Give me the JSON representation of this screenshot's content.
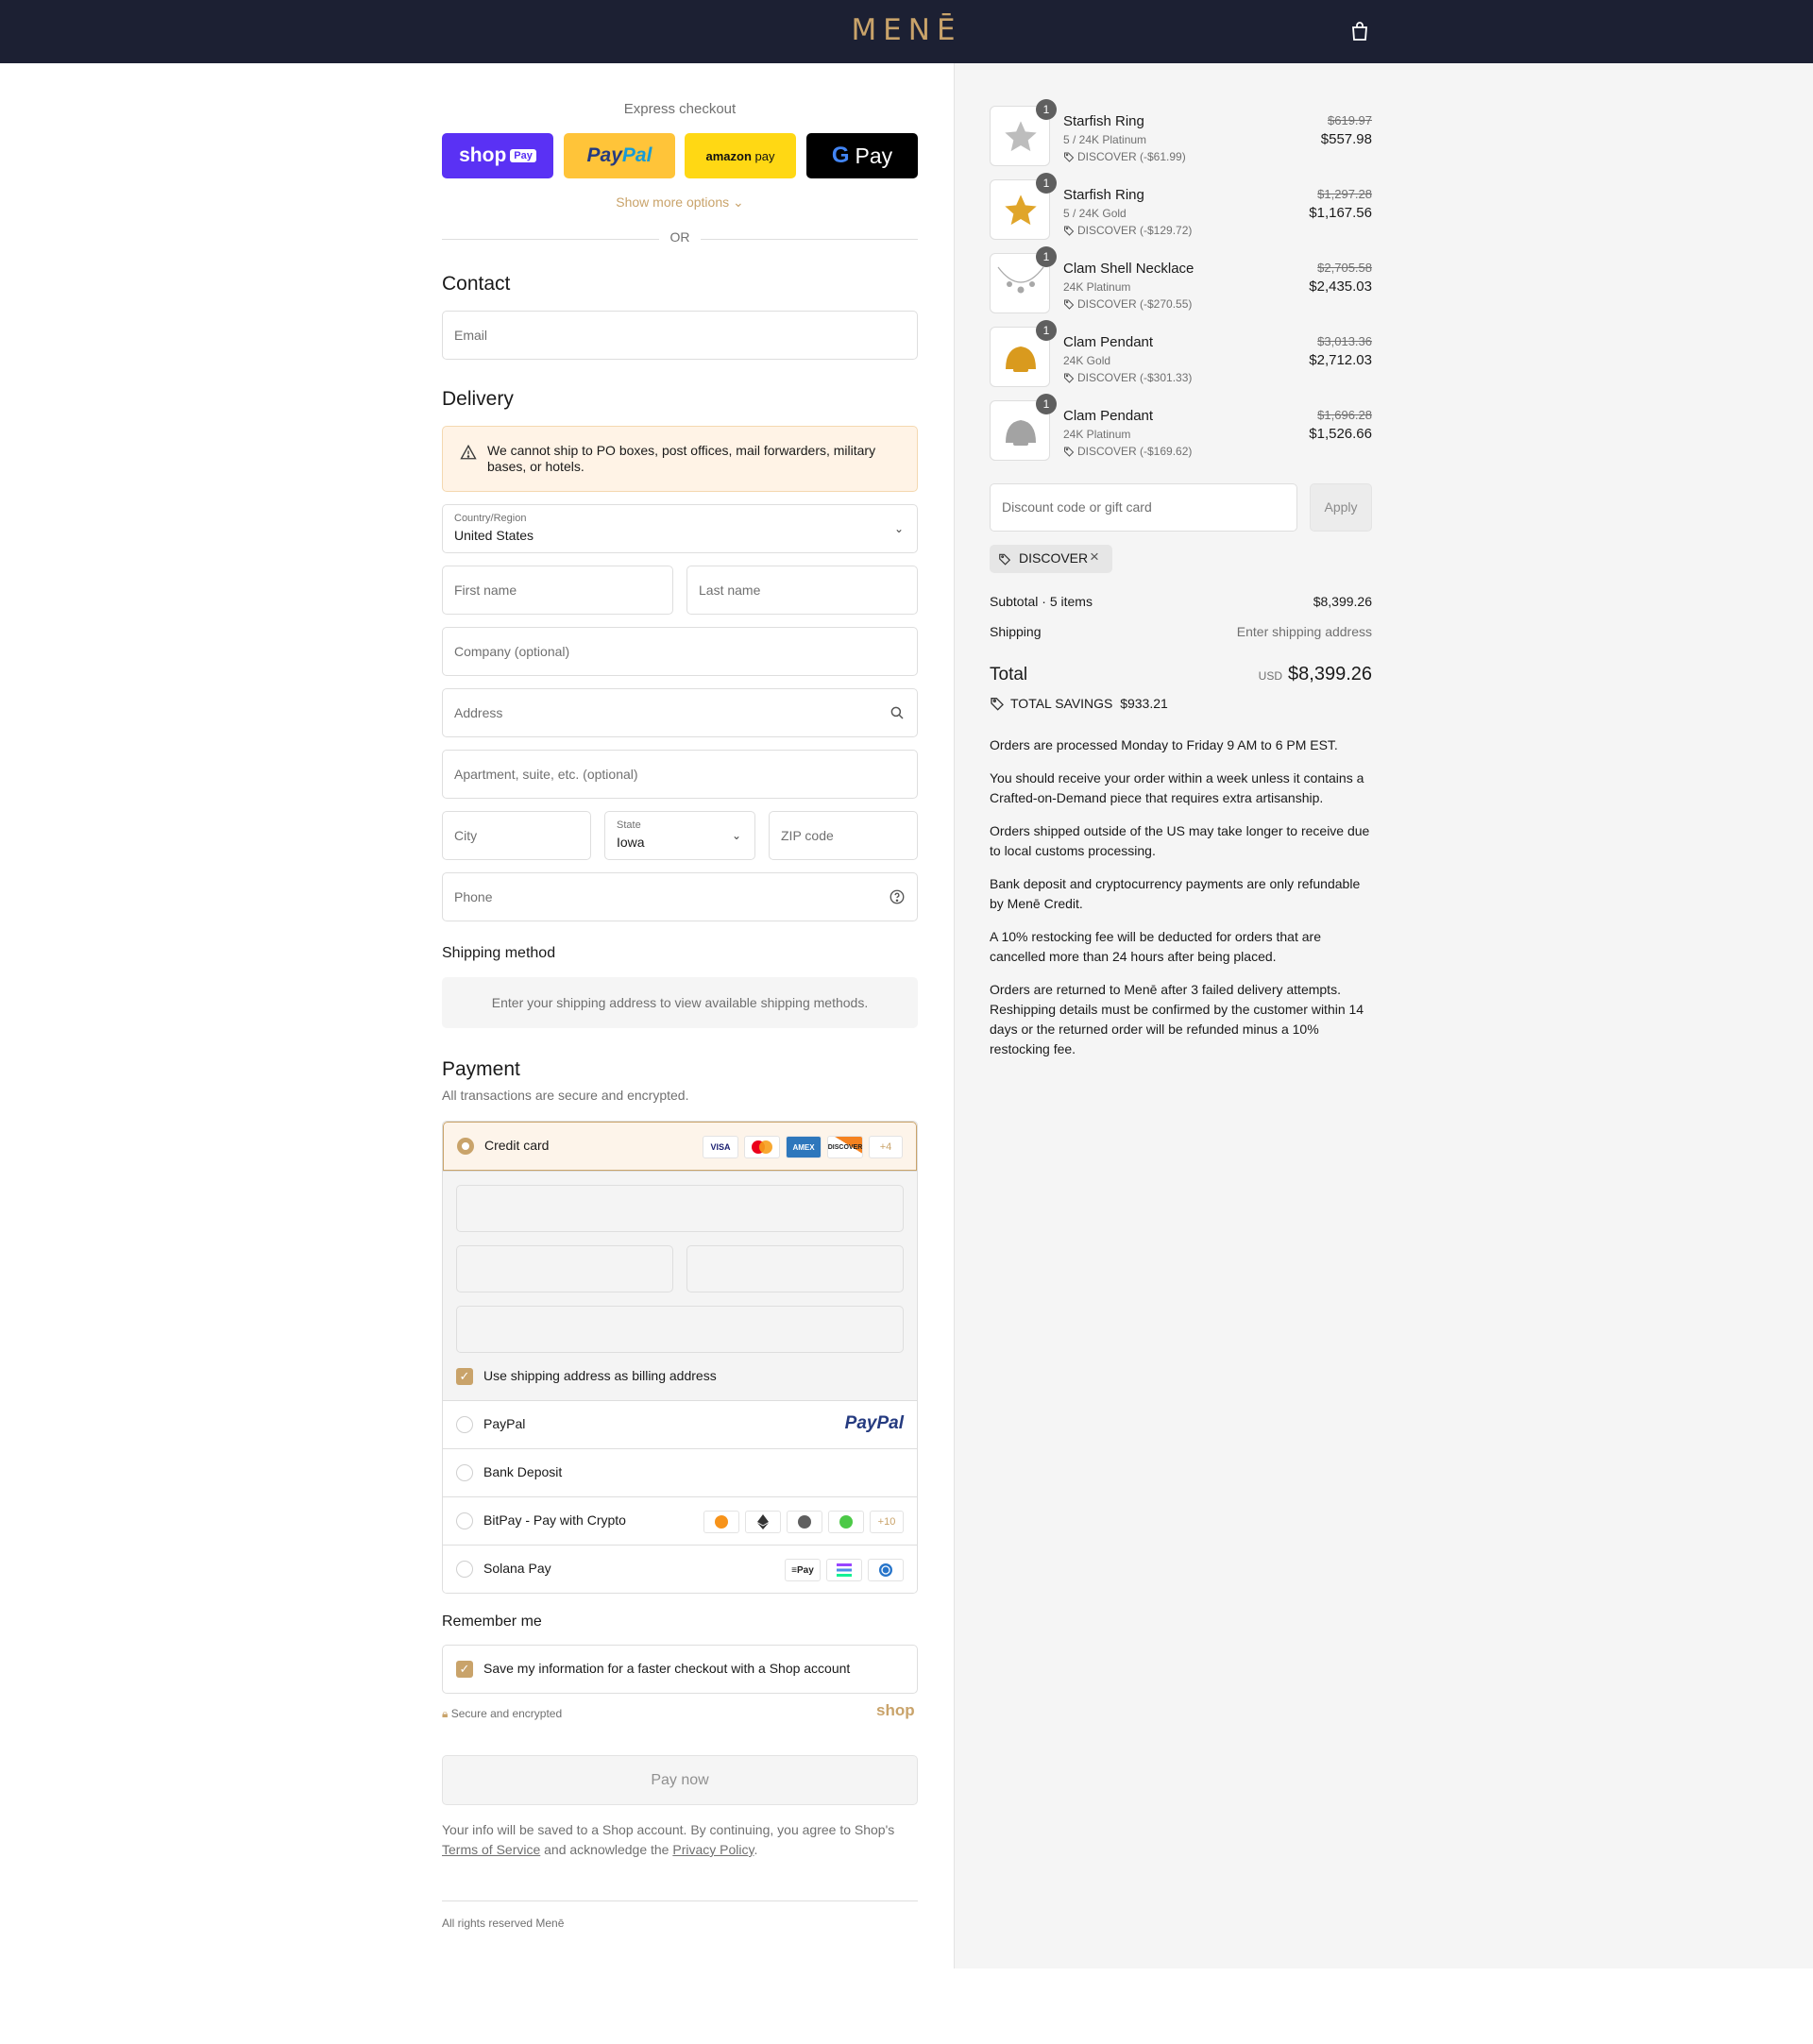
{
  "header": {
    "logo": "MENĒ"
  },
  "express": {
    "title": "Express checkout",
    "shop_label": "shop",
    "shop_pill": "Pay",
    "paypal_1": "Pay",
    "paypal_2": "Pal",
    "amazon_1": "amazon",
    "amazon_2": "pay",
    "gpay_g": "G",
    "gpay_label": "Pay",
    "show_more": "Show more options ⌄",
    "or": "OR"
  },
  "contact": {
    "title": "Contact",
    "email_placeholder": "Email"
  },
  "delivery": {
    "title": "Delivery",
    "warning": "We cannot ship to PO boxes, post offices, mail forwarders, military bases, or hotels.",
    "country_label": "Country/Region",
    "country_value": "United States",
    "first_name": "First name",
    "last_name": "Last name",
    "company": "Company (optional)",
    "address": "Address",
    "apartment": "Apartment, suite, etc. (optional)",
    "city": "City",
    "state_label": "State",
    "state_value": "Iowa",
    "zip": "ZIP code",
    "phone": "Phone"
  },
  "shipping": {
    "title": "Shipping method",
    "message": "Enter your shipping address to view available shipping methods."
  },
  "payment": {
    "title": "Payment",
    "subtitle": "All transactions are secure and encrypted.",
    "credit_card": "Credit card",
    "card_logos": [
      "VISA",
      "MC",
      "AMEX",
      "DISCOVER"
    ],
    "card_more": "+4",
    "billing_same": "Use shipping address as billing address",
    "paypal": "PayPal",
    "paypal_logo": "PayPal",
    "bank": "Bank Deposit",
    "bitpay": "BitPay - Pay with Crypto",
    "crypto_more": "+10",
    "solana": "Solana Pay",
    "solana_pay_logo": "≡Pay"
  },
  "remember": {
    "title": "Remember me",
    "save_info": "Save my information for a faster checkout with a Shop account",
    "secure": "Secure and encrypted",
    "shop": "shop"
  },
  "pay_now": "Pay now",
  "legal": {
    "text_1": "Your info will be saved to a Shop account. By continuing, you agree to Shop's ",
    "terms": "Terms of Service",
    "text_2": " and acknowledge the ",
    "privacy": "Privacy Policy",
    "text_3": "."
  },
  "footer": "All rights reserved Menē",
  "order": {
    "items": [
      {
        "qty": "1",
        "name": "Starfish Ring",
        "variant": "5 / 24K Platinum",
        "discount": "DISCOVER (-$61.99)",
        "old_price": "$619.97",
        "price": "$557.98",
        "color": "#bdbdbd"
      },
      {
        "qty": "1",
        "name": "Starfish Ring",
        "variant": "5 / 24K Gold",
        "discount": "DISCOVER (-$129.72)",
        "old_price": "$1,297.28",
        "price": "$1,167.56",
        "color": "#e0a52a"
      },
      {
        "qty": "1",
        "name": "Clam Shell Necklace",
        "variant": "24K Platinum",
        "discount": "DISCOVER (-$270.55)",
        "old_price": "$2,705.58",
        "price": "$2,435.03",
        "color": "#a8a8a8"
      },
      {
        "qty": "1",
        "name": "Clam Pendant",
        "variant": "24K Gold",
        "discount": "DISCOVER (-$301.33)",
        "old_price": "$3,013.36",
        "price": "$2,712.03",
        "color": "#d99a1e"
      },
      {
        "qty": "1",
        "name": "Clam Pendant",
        "variant": "24K Platinum",
        "discount": "DISCOVER (-$169.62)",
        "old_price": "$1,696.28",
        "price": "$1,526.66",
        "color": "#a3a3a3"
      }
    ],
    "discount_placeholder": "Discount code or gift card",
    "apply": "Apply",
    "applied_code": "DISCOVER",
    "subtotal_label": "Subtotal · 5 items",
    "subtotal_value": "$8,399.26",
    "shipping_label": "Shipping",
    "shipping_value": "Enter shipping address",
    "total_label": "Total",
    "currency": "USD",
    "total_value": "$8,399.26",
    "savings_label": "TOTAL SAVINGS",
    "savings_value": "$933.21",
    "policies": [
      "Orders are processed Monday to Friday 9 AM to 6 PM EST.",
      "You should receive your order within a week unless it contains a Crafted-on-Demand piece that requires extra artisanship.",
      "Orders shipped outside of the US may take longer to receive due to local customs processing.",
      "Bank deposit and cryptocurrency payments are only refundable by Menē Credit.",
      "A 10% restocking fee will be deducted for orders that are cancelled more than 24 hours after being placed.",
      "Orders are returned to Menē after 3 failed delivery attempts. Reshipping details must be confirmed by the customer within 14 days or the returned order will be refunded minus a 10% restocking fee."
    ]
  }
}
